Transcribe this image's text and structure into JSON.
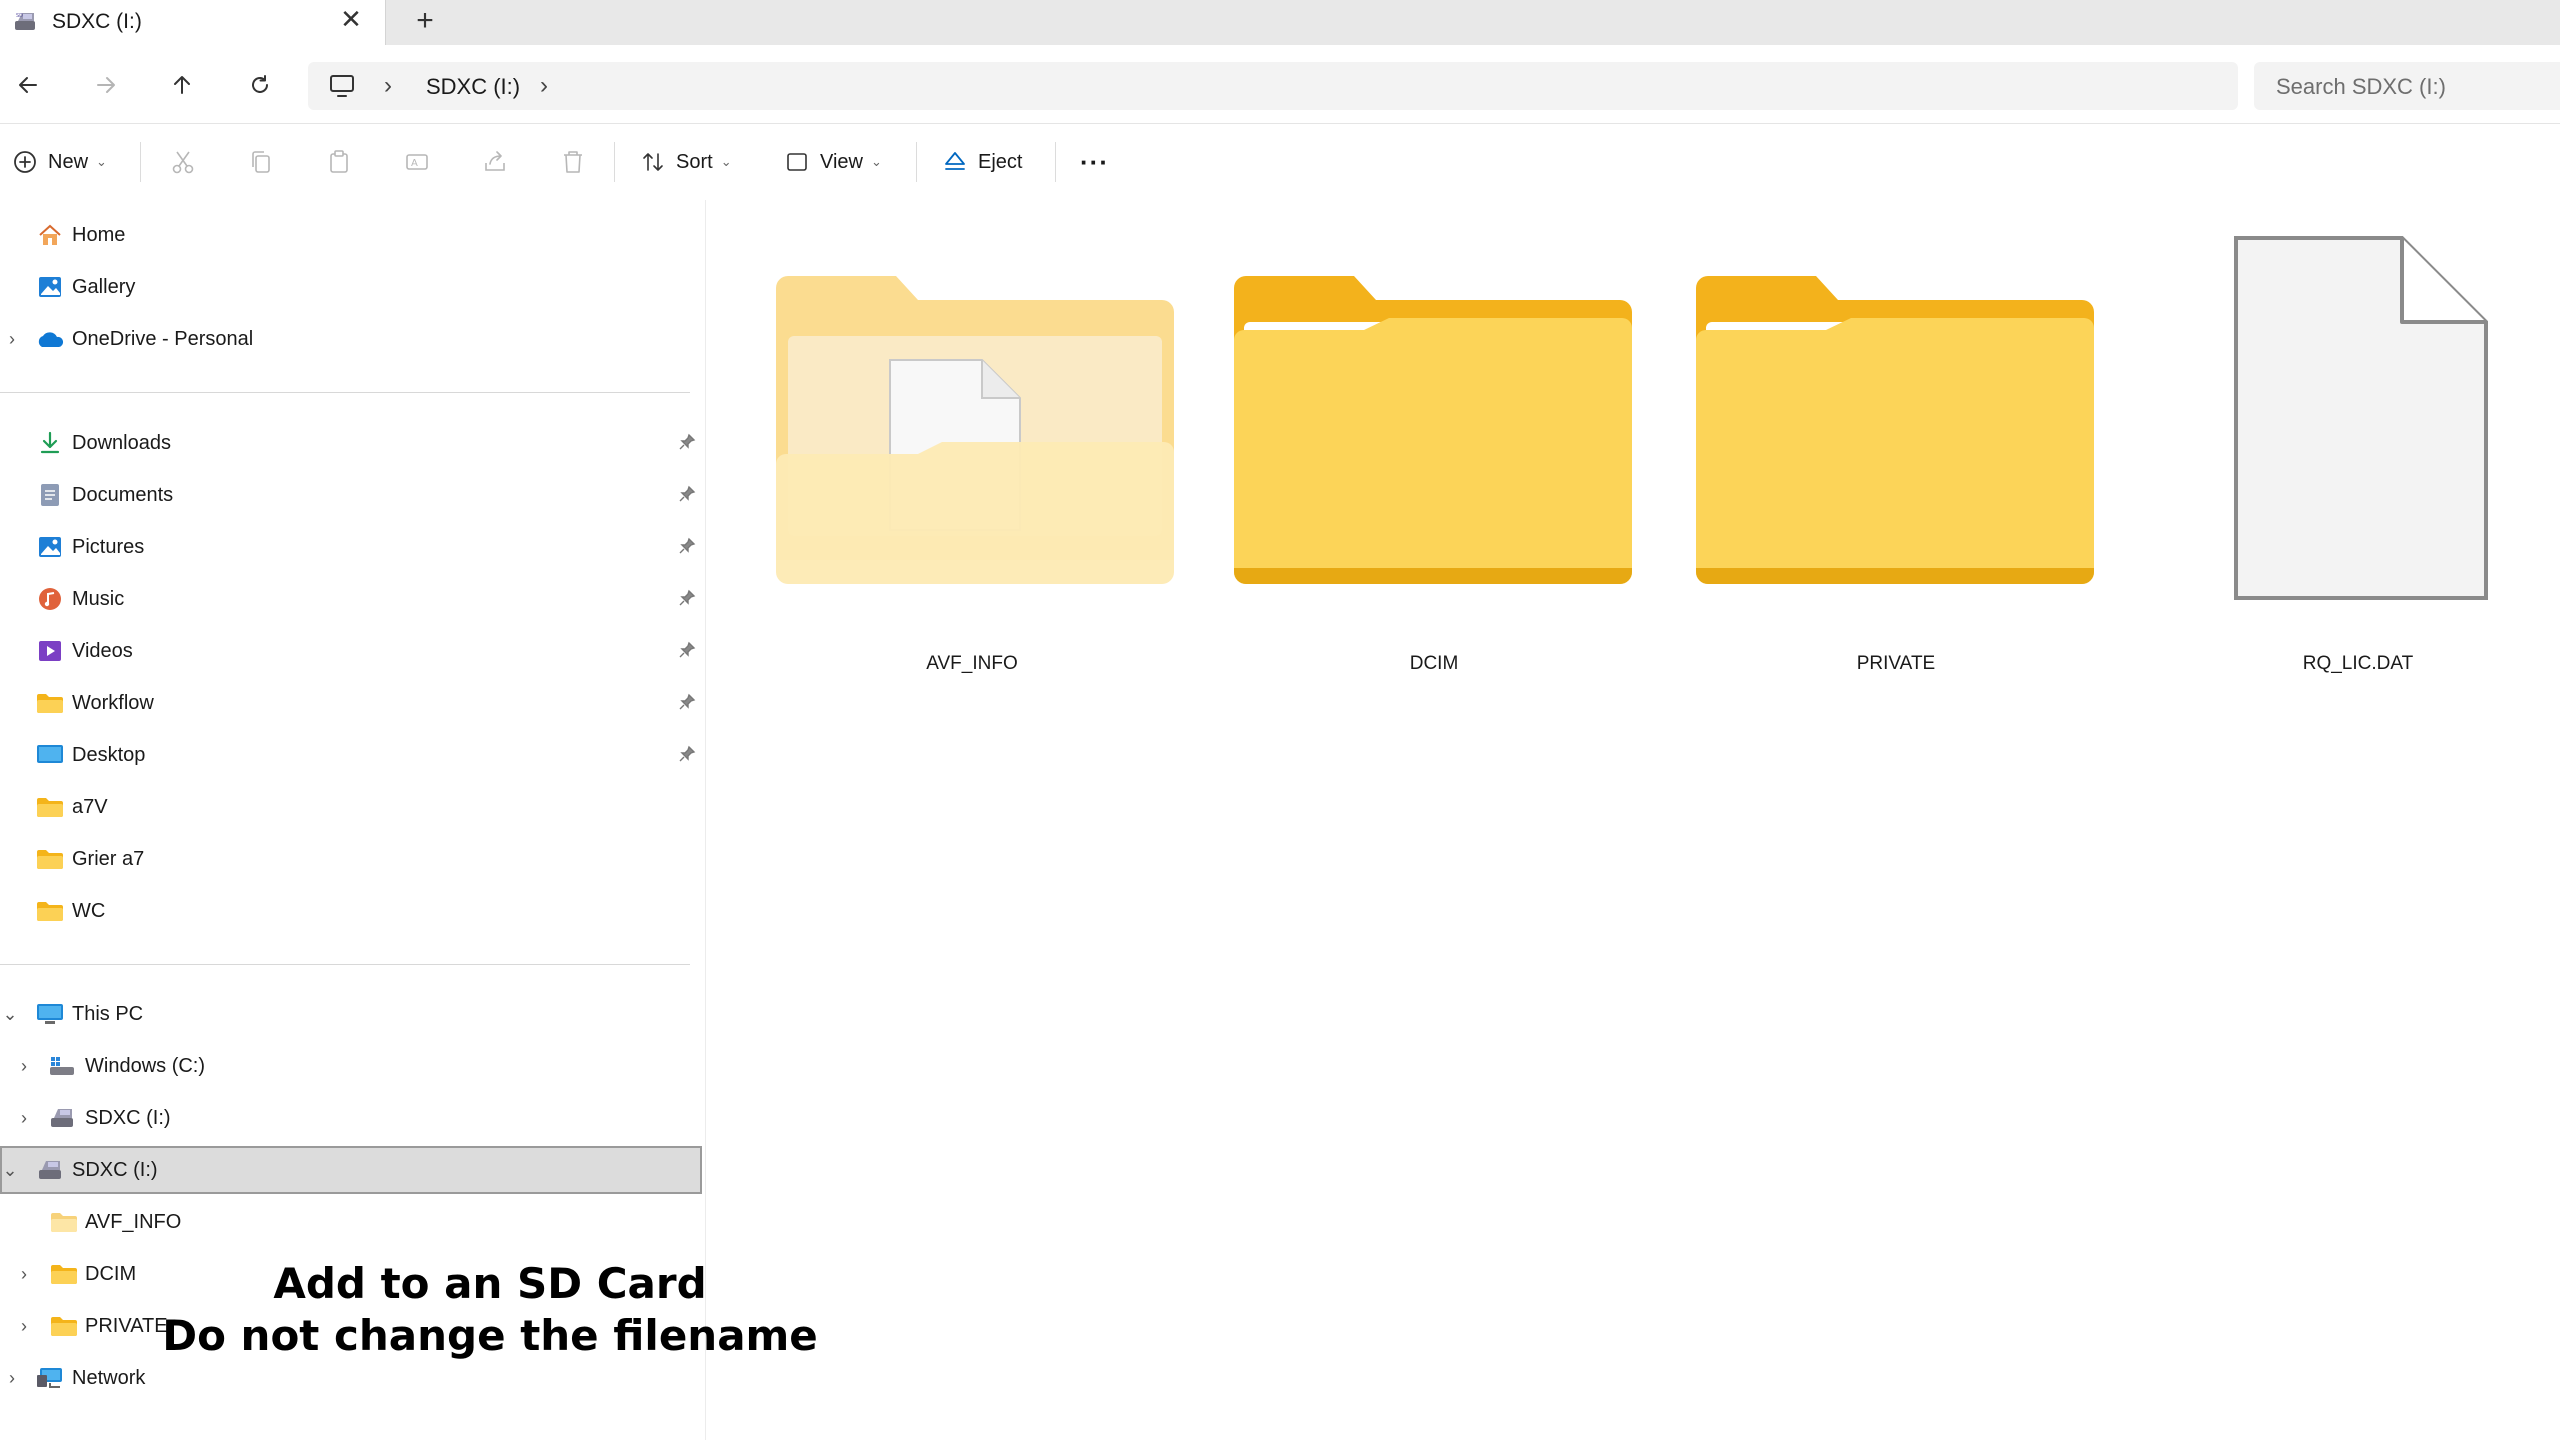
{
  "tab": {
    "title": "SDXC (I:)",
    "close": "✕",
    "new_tab": "+"
  },
  "address": {
    "breadcrumb": "SDXC (I:)",
    "separator": "›",
    "search_placeholder": "Search SDXC (I:)"
  },
  "toolbar": {
    "new": "New",
    "sort": "Sort",
    "view": "View",
    "eject": "Eject",
    "more": "···"
  },
  "sidebar": {
    "quick": [
      "Home",
      "Gallery",
      "OneDrive - Personal"
    ],
    "pinned": [
      "Downloads",
      "Documents",
      "Pictures",
      "Music",
      "Videos",
      "Workflow",
      "Desktop",
      "a7V",
      "Grier a7",
      "WC"
    ],
    "this_pc": "This PC",
    "drives": [
      "Windows (C:)",
      "SDXC (I:)"
    ],
    "selected_drive": "SDXC (I:)",
    "children": [
      "AVF_INFO",
      "DCIM",
      "PRIVATE"
    ],
    "network": "Network"
  },
  "items": [
    {
      "name": "AVF_INFO",
      "kind": "folder-with-file"
    },
    {
      "name": "DCIM",
      "kind": "folder"
    },
    {
      "name": "PRIVATE",
      "kind": "folder"
    },
    {
      "name": "RQ_LIC.DAT",
      "kind": "file"
    }
  ],
  "caption": {
    "line1": "Add to an SD Card",
    "line2": "Do not change the filename"
  },
  "colors": {
    "folder_back": "#f9c42f",
    "folder_front": "#fcd769",
    "selected_bg": "#dcdcdc",
    "accent": "#0067c0"
  }
}
